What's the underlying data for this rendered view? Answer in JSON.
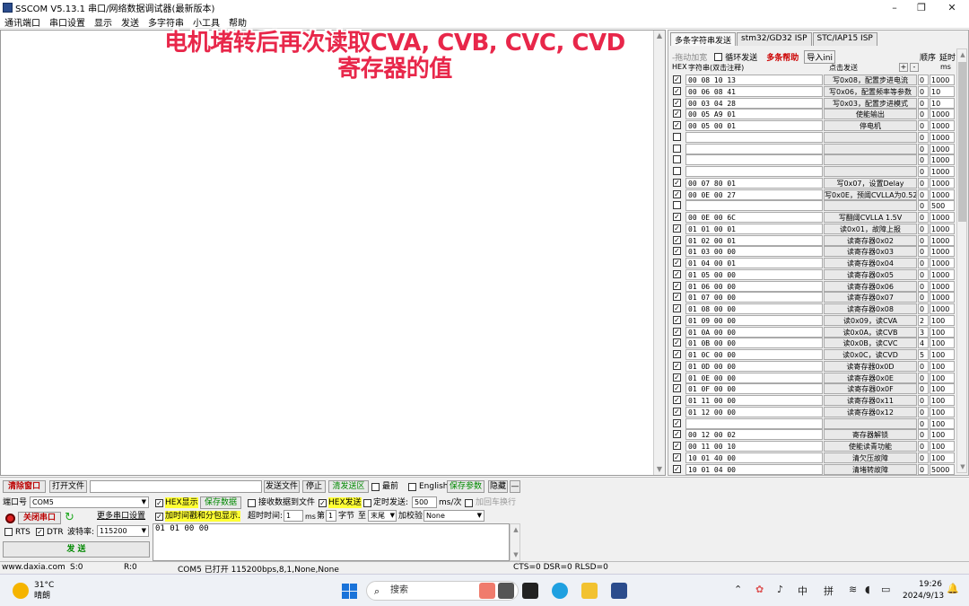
{
  "window": {
    "title": "SSCOM V5.13.1 串口/网络数据调试器(最新版本)",
    "min": "–",
    "max": "❐",
    "close": "✕"
  },
  "menu": [
    "通讯端口",
    "串口设置",
    "显示",
    "发送",
    "多字符串",
    "小工具",
    "帮助"
  ],
  "overlay": {
    "line1": "电机堵转后再次读取CVA, CVB, CVC, CVD",
    "line2": "寄存器的值"
  },
  "tabs": [
    "多条字符串发送",
    "stm32/GD32 ISP",
    "STC/IAP15 ISP"
  ],
  "multi": {
    "expand": "-拖动加宽",
    "loop": "循环发送",
    "help": "多条帮助",
    "import": "导入ini",
    "order": "顺序",
    "delay": "延时",
    "hex": "HEX",
    "str_col": "字符串(双击注释)",
    "click_col": "点击发送",
    "plus": "+",
    "minus": "-",
    "ms": "ms"
  },
  "rows": [
    {
      "c": true,
      "h": "00 08 10 13",
      "b": "写0x08，配置步进电流",
      "o": "0",
      "d": "1000"
    },
    {
      "c": true,
      "h": "00 06 08 41",
      "b": "写0x06，配置频率等参数",
      "o": "0",
      "d": "10"
    },
    {
      "c": true,
      "h": "00 03 04 28",
      "b": "写0x03，配置步进模式",
      "o": "0",
      "d": "10"
    },
    {
      "c": true,
      "h": "00 05 A9 01",
      "b": "使能输出",
      "o": "0",
      "d": "1000"
    },
    {
      "c": true,
      "h": "00 05 00 01",
      "b": "停电机",
      "o": "0",
      "d": "1000"
    },
    {
      "c": false,
      "h": "",
      "b": "",
      "o": "0",
      "d": "1000"
    },
    {
      "c": false,
      "h": "",
      "b": "",
      "o": "0",
      "d": "1000"
    },
    {
      "c": false,
      "h": "",
      "b": "",
      "o": "0",
      "d": "1000"
    },
    {
      "c": false,
      "h": "",
      "b": "",
      "o": "0",
      "d": "1000"
    },
    {
      "c": true,
      "h": "00 07 80 01",
      "b": "写0x07，设置Delay",
      "o": "0",
      "d": "1000"
    },
    {
      "c": true,
      "h": "00 0E 00 27",
      "b": "写0x0E，预阈CVLLA为0.52",
      "o": "0",
      "d": "1000"
    },
    {
      "c": false,
      "h": "",
      "b": "",
      "o": "0",
      "d": "500"
    },
    {
      "c": true,
      "h": "00 0E 00 6C",
      "b": "写翻阈CVLLA 1.5V",
      "o": "0",
      "d": "1000"
    },
    {
      "c": true,
      "h": "01 01 00 01",
      "b": "读0x01，故障上报",
      "o": "0",
      "d": "1000"
    },
    {
      "c": true,
      "h": "01 02 00 01",
      "b": "读寄存器0x02",
      "o": "0",
      "d": "1000"
    },
    {
      "c": true,
      "h": "01 03 00 00",
      "b": "读寄存器0x03",
      "o": "0",
      "d": "1000"
    },
    {
      "c": true,
      "h": "01 04 00 01",
      "b": "读寄存器0x04",
      "o": "0",
      "d": "1000"
    },
    {
      "c": true,
      "h": "01 05 00 00",
      "b": "读寄存器0x05",
      "o": "0",
      "d": "1000"
    },
    {
      "c": true,
      "h": "01 06 00 00",
      "b": "读寄存器0x06",
      "o": "0",
      "d": "1000"
    },
    {
      "c": true,
      "h": "01 07 00 00",
      "b": "读寄存器0x07",
      "o": "0",
      "d": "1000"
    },
    {
      "c": true,
      "h": "01 08 00 00",
      "b": "读寄存器0x08",
      "o": "0",
      "d": "1000"
    },
    {
      "c": true,
      "h": "01 09 00 00",
      "b": "读0x09，读CVA",
      "o": "2",
      "d": "100"
    },
    {
      "c": true,
      "h": "01 0A 00 00",
      "b": "读0x0A，读CVB",
      "o": "3",
      "d": "100"
    },
    {
      "c": true,
      "h": "01 0B 00 00",
      "b": "读0x0B，读CVC",
      "o": "4",
      "d": "100"
    },
    {
      "c": true,
      "h": "01 0C 00 00",
      "b": "读0x0C，读CVD",
      "o": "5",
      "d": "100"
    },
    {
      "c": true,
      "h": "01 0D 00 00",
      "b": "读寄存器0x0D",
      "o": "0",
      "d": "100"
    },
    {
      "c": true,
      "h": "01 0E 00 00",
      "b": "读寄存器0x0E",
      "o": "0",
      "d": "100"
    },
    {
      "c": true,
      "h": "01 0F 00 00",
      "b": "读寄存器0x0F",
      "o": "0",
      "d": "100"
    },
    {
      "c": true,
      "h": "01 11 00 00",
      "b": "读寄存器0x11",
      "o": "0",
      "d": "100"
    },
    {
      "c": true,
      "h": "01 12 00 00",
      "b": "读寄存器0x12",
      "o": "0",
      "d": "100"
    },
    {
      "c": true,
      "h": "",
      "b": "",
      "o": "0",
      "d": "100"
    },
    {
      "c": true,
      "h": "00 12 00 02",
      "b": "寄存器解锁",
      "o": "0",
      "d": "100"
    },
    {
      "c": true,
      "h": "00 11 00 10",
      "b": "使能读青功能",
      "o": "0",
      "d": "100"
    },
    {
      "c": true,
      "h": "10 01 40 00",
      "b": "清欠压故障",
      "o": "0",
      "d": "100"
    },
    {
      "c": true,
      "h": "10 01 04 00",
      "b": "清堵转故障",
      "o": "0",
      "d": "5000"
    }
  ],
  "ctrl": {
    "clear": "清除窗口",
    "open_file": "打开文件",
    "send_file": "发送文件",
    "stop": "停止",
    "clear_send": "清发送区",
    "top": "最前",
    "english": "English",
    "save_params": "保存参数",
    "hide": "隐藏",
    "collapse": "—",
    "port_label": "端口号",
    "port": "COM5",
    "close_port": "关闭串口",
    "multi_set": "更多串口设置",
    "rts": "RTS",
    "dtr": "DTR",
    "baud_label": "波特率:",
    "baud": "115200",
    "send": "发  送",
    "hex_show": "HEX显示",
    "save_data": "保存数据",
    "recv_to_file": "接收数据到文件",
    "hex_send": "HEX发送",
    "timed_send": "定时发送:",
    "interval": "500",
    "ms_per": "ms/次",
    "add_crlf": "加回车换行",
    "timestamp": "加时间戳和分包显示.",
    "timeout_label": "超时时间:",
    "timeout": "1",
    "ms": "ms",
    "nth": "第",
    "byte_n": "1",
    "byte": "字节",
    "to": "至",
    "tail": "末尾",
    "checksum_label": "加校验",
    "checksum": "None",
    "send_text": "01 01 00 00"
  },
  "status": {
    "site": "www.daxia.com",
    "s": "S:0",
    "r": "R:0",
    "port": "COM5 已打开  115200bps,8,1,None,None",
    "lines": "CTS=0 DSR=0 RLSD=0"
  },
  "taskbar": {
    "temp": "31°C",
    "weather": "晴朗",
    "search": "搜索",
    "ime1": "中",
    "ime2": "拼",
    "time": "19:26",
    "date": "2024/9/13"
  }
}
